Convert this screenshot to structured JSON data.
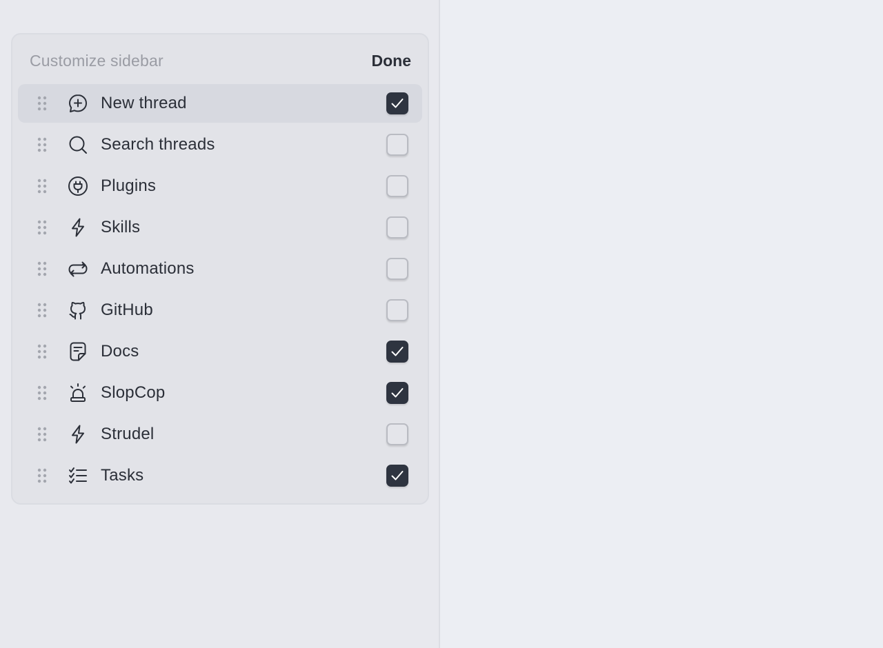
{
  "colors": {
    "sidebar_bg": "#e8e9ee",
    "panel_bg": "#e2e3e8",
    "active_row_bg": "#d7d9e0",
    "checkbox_checked": "#2e3440",
    "text": "#2b2f38",
    "muted_text": "#9a9ca4"
  },
  "panel": {
    "title": "Customize sidebar",
    "done_label": "Done"
  },
  "items": [
    {
      "label": "New thread",
      "icon": "new-thread-icon",
      "checked": true
    },
    {
      "label": "Search threads",
      "icon": "search-icon",
      "checked": false
    },
    {
      "label": "Plugins",
      "icon": "plug-icon",
      "checked": false
    },
    {
      "label": "Skills",
      "icon": "lightning-icon",
      "checked": false
    },
    {
      "label": "Automations",
      "icon": "repeat-icon",
      "checked": false
    },
    {
      "label": "GitHub",
      "icon": "github-icon",
      "checked": false
    },
    {
      "label": "Docs",
      "icon": "document-icon",
      "checked": true
    },
    {
      "label": "SlopCop",
      "icon": "siren-icon",
      "checked": true
    },
    {
      "label": "Strudel",
      "icon": "lightning-icon",
      "checked": false
    },
    {
      "label": "Tasks",
      "icon": "task-list-icon",
      "checked": true
    }
  ]
}
